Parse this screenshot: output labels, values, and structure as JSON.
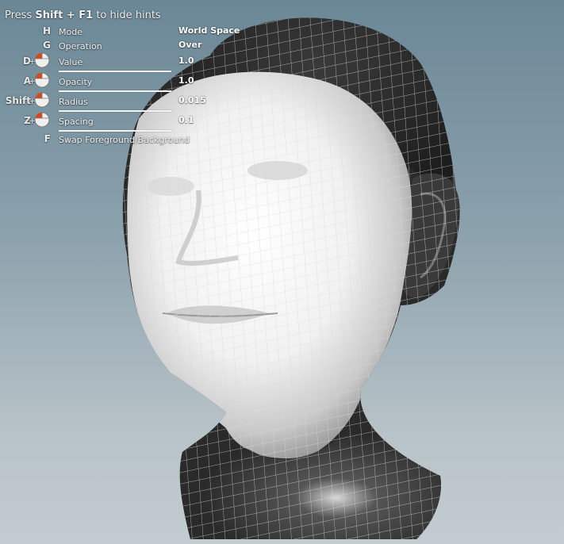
{
  "hint": {
    "prefix": "Press",
    "shortcut": "Shift + F1",
    "suffix": "to hide hints"
  },
  "hotkeys": [
    {
      "key": "H",
      "label": "Mode",
      "value": "World Space",
      "mouse": false
    },
    {
      "key": "G",
      "label": "Operation",
      "value": "Over",
      "mouse": false
    },
    {
      "key": "D",
      "label": "Value",
      "value": "1.0",
      "mouse": true
    },
    {
      "key": "A",
      "label": "Opacity",
      "value": "1.0",
      "mouse": true
    },
    {
      "key": "Shift",
      "label": "Radius",
      "value": "0.015",
      "mouse": true
    },
    {
      "key": "Z",
      "label": "Spacing",
      "value": "0.1",
      "mouse": true
    },
    {
      "key": "F",
      "label": "Swap Foreground/Background",
      "value": "",
      "mouse": false
    }
  ],
  "plus_sign": "+",
  "colors": {
    "background_top": "#6b8796",
    "background_bottom": "#c3ccd0",
    "mesh_dark": "#2a2a2a",
    "mesh_light": "#f4f4f4",
    "wire": "#ffffff",
    "mouse_button_accent": "#d9481c"
  },
  "icons": {
    "mouse": "mouse-left-button-icon"
  },
  "viewport": {
    "object": "head-mesh",
    "display": "wireframe-on-shaded"
  }
}
